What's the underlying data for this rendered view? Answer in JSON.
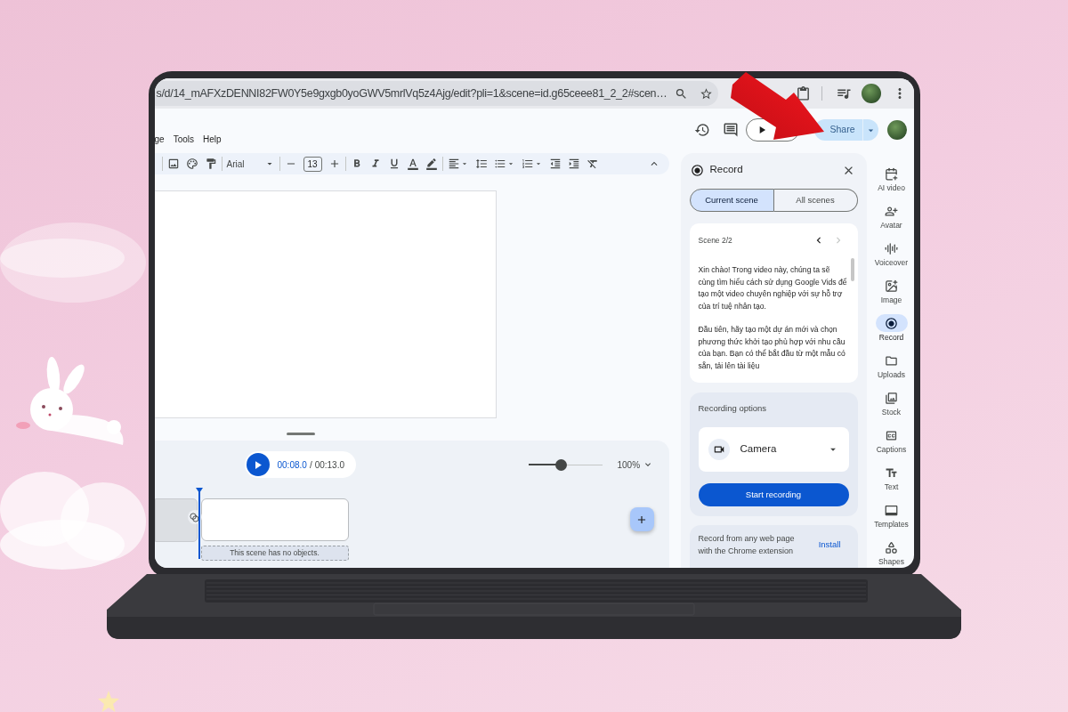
{
  "browser": {
    "url": "s/d/14_mAFXzDENNI82FW0Y5e9gxgb0yoGWV5mrlVq5z4Ajg/edit?pli=1&scene=id.g65ceee81_2_2#scen…"
  },
  "menu": [
    {
      "label": "ge"
    },
    {
      "label": "Tools"
    },
    {
      "label": "Help"
    }
  ],
  "header": {
    "share_label": "Share"
  },
  "toolbar": {
    "font": "Arial",
    "font_size": "13"
  },
  "timeline": {
    "current_time": "00:08.0",
    "separator": "/",
    "total_time": "00:13.0",
    "zoom": {
      "level": 0.45
    },
    "zoom_label": "100%",
    "scene_note": "This scene has no objects."
  },
  "record_panel": {
    "title": "Record",
    "tabs": [
      {
        "label": "Current scene",
        "selected": true
      },
      {
        "label": "All scenes",
        "selected": false
      }
    ],
    "scene_label": "Scene 2/2",
    "nav": [
      {
        "kind": "prev",
        "disabled": false
      },
      {
        "kind": "next",
        "disabled": true
      }
    ],
    "script": [
      "Xin chào! Trong video này, chúng ta sẽ cùng tìm hiểu cách sử dụng Google Vids để tạo một video chuyên nghiệp với sự hỗ trợ của trí tuệ nhân tạo.",
      "Đầu tiên, hãy tạo một dự án mới và chọn phương thức khởi tạo phù hợp với nhu cầu của bạn. Bạn có thể bắt đầu từ một mẫu có sẵn, tải lên tài liệu"
    ],
    "options_title": "Recording options",
    "source": "Camera",
    "start_label": "Start recording",
    "extension_text": "Record from any web page with the Chrome extension",
    "install_label": "Install"
  },
  "rail": [
    {
      "kind": "ai_video",
      "label": "AI video",
      "selected": false
    },
    {
      "kind": "avatar",
      "label": "Avatar",
      "selected": false
    },
    {
      "kind": "voiceover",
      "label": "Voiceover",
      "selected": false
    },
    {
      "kind": "image",
      "label": "Image",
      "selected": false
    },
    {
      "kind": "record",
      "label": "Record",
      "selected": true
    },
    {
      "kind": "uploads",
      "label": "Uploads",
      "selected": false
    },
    {
      "kind": "stock",
      "label": "Stock",
      "selected": false
    },
    {
      "kind": "captions",
      "label": "Captions",
      "selected": false
    },
    {
      "kind": "text",
      "label": "Text",
      "selected": false
    },
    {
      "kind": "templates",
      "label": "Templates",
      "selected": false
    },
    {
      "kind": "shapes",
      "label": "Shapes",
      "selected": false
    }
  ]
}
